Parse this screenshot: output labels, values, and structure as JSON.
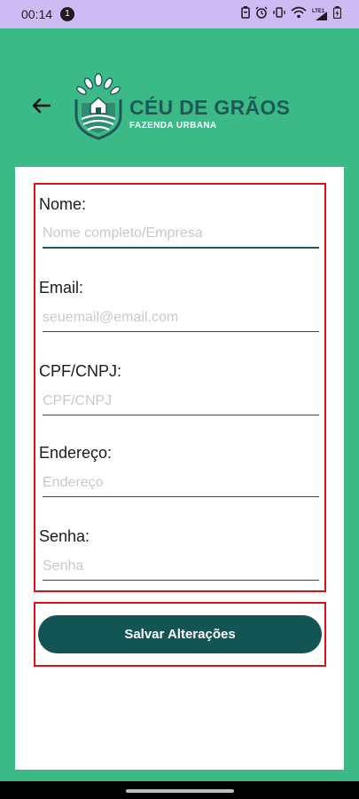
{
  "status_bar": {
    "time": "00:14",
    "notification_count": "1",
    "icons": [
      "battery-saver-icon",
      "alarm-icon",
      "vibrate-icon",
      "wifi-icon",
      "signal-lte-icon",
      "battery-charging-icon"
    ],
    "network_label": "LTE1"
  },
  "header": {
    "brand_name": "CÉU DE GRÃOS",
    "brand_subtitle": "FAZENDA URBANA",
    "brand_color": "#1E5957"
  },
  "form": {
    "fields": [
      {
        "label": "Nome:",
        "placeholder": "Nome completo/Empresa",
        "value": ""
      },
      {
        "label": "Email:",
        "placeholder": "seuemail@email.com",
        "value": ""
      },
      {
        "label": "CPF/CNPJ:",
        "placeholder": "CPF/CNPJ",
        "value": ""
      },
      {
        "label": "Endereço:",
        "placeholder": "Endereço",
        "value": ""
      },
      {
        "label": "Senha:",
        "placeholder": "Senha",
        "value": ""
      }
    ]
  },
  "actions": {
    "save_label": "Salvar Alterações"
  },
  "colors": {
    "background": "#3BBA87",
    "status_bar": "#CDBCF3",
    "button": "#135455",
    "highlight_border": "#E0101A"
  }
}
